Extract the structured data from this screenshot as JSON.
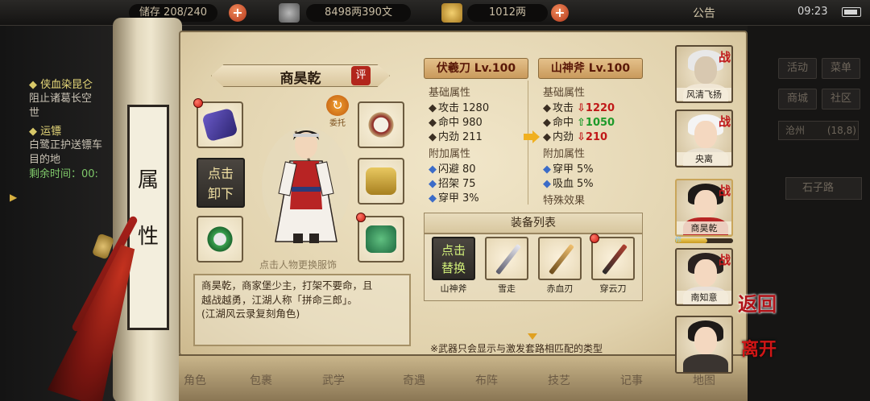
{
  "topbar": {
    "inventory": "储存 208/240",
    "money": "8498两390文",
    "gold": "1012两",
    "announce": "公告",
    "time": "09:23"
  },
  "quests": [
    {
      "title": "侠血染昆仑",
      "body": [
        "阻止诸葛长空",
        "世"
      ]
    },
    {
      "title": "运镖",
      "body": [
        "白鹭正护送镖车",
        "目的地"
      ],
      "time": "剩余时间：00:"
    }
  ],
  "scroll": {
    "chars": [
      "属",
      "性"
    ]
  },
  "character": {
    "name": "商昊乾",
    "rate_badge": "评",
    "entrust_label": "委托",
    "unload_button": [
      "点击",
      "卸下"
    ],
    "hint": "点击人物更换服饰",
    "description": [
      "商昊乾，商家堡少主，打架不要命，且",
      "越战越勇，江湖人称「拼命三郎」。",
      "(江湖风云录复刻角色)"
    ]
  },
  "current_weapon": {
    "title": "伏羲刀 Lv.100",
    "base_title": "基础属性",
    "base_stats": [
      {
        "name": "攻击",
        "value": "1280"
      },
      {
        "name": "命中",
        "value": "980"
      },
      {
        "name": "内劲",
        "value": "211"
      }
    ],
    "extra_title": "附加属性",
    "extra_stats": [
      {
        "name": "闪避",
        "value": "80"
      },
      {
        "name": "招架",
        "value": "75"
      },
      {
        "name": "穿甲",
        "value": "3%"
      }
    ]
  },
  "compare_weapon": {
    "title": "山神斧 Lv.100",
    "base_title": "基础属性",
    "base_stats": [
      {
        "name": "攻击",
        "value": "1220",
        "trend": "down"
      },
      {
        "name": "命中",
        "value": "1050",
        "trend": "up"
      },
      {
        "name": "内劲",
        "value": "210",
        "trend": "down"
      }
    ],
    "extra_title": "附加属性",
    "extra_stats": [
      {
        "name": "穿甲",
        "value": "5%"
      },
      {
        "name": "吸血",
        "value": "5%"
      }
    ],
    "special_title": "特殊效果"
  },
  "equip_list": {
    "header": "装备列表",
    "replace_button": [
      "点击",
      "替换"
    ],
    "items": [
      "山神斧",
      "雪走",
      "赤血刃",
      "穿云刀"
    ],
    "note": "※武器只会显示与激发套路相匹配的类型"
  },
  "right_menu": {
    "buttons": [
      "活动",
      "菜单",
      "商城",
      "社区"
    ],
    "location": "沧州",
    "location_coord": "(18,8)",
    "road": "石子路"
  },
  "portraits": [
    {
      "name": "风清飞扬",
      "tag": "战"
    },
    {
      "name": "央离",
      "tag": "战"
    },
    {
      "name": "商昊乾",
      "tag": "战"
    },
    {
      "name": "南知意",
      "tag": "战"
    },
    {
      "name": "",
      "tag": ""
    }
  ],
  "hp_label": "修",
  "hp_level": 0.55,
  "actions": {
    "return": "返回",
    "leave": "离开"
  },
  "bottom_menu": [
    "角色",
    "包裹",
    "武学",
    "奇遇",
    "布阵",
    "技艺",
    "记事",
    "地图"
  ],
  "colors": {
    "accent_red": "#c0181a",
    "stat_up": "#1e9a2a",
    "stat_down": "#c01818",
    "title_text": "#5a1808"
  }
}
